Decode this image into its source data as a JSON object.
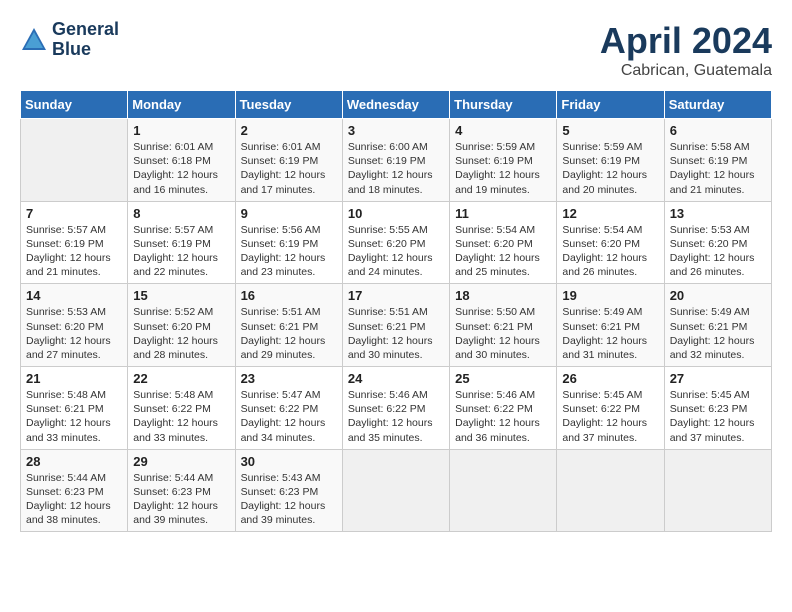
{
  "header": {
    "logo_line1": "General",
    "logo_line2": "Blue",
    "month": "April 2024",
    "location": "Cabrican, Guatemala"
  },
  "weekdays": [
    "Sunday",
    "Monday",
    "Tuesday",
    "Wednesday",
    "Thursday",
    "Friday",
    "Saturday"
  ],
  "weeks": [
    [
      {
        "num": "",
        "info": ""
      },
      {
        "num": "1",
        "info": "Sunrise: 6:01 AM\nSunset: 6:18 PM\nDaylight: 12 hours\nand 16 minutes."
      },
      {
        "num": "2",
        "info": "Sunrise: 6:01 AM\nSunset: 6:19 PM\nDaylight: 12 hours\nand 17 minutes."
      },
      {
        "num": "3",
        "info": "Sunrise: 6:00 AM\nSunset: 6:19 PM\nDaylight: 12 hours\nand 18 minutes."
      },
      {
        "num": "4",
        "info": "Sunrise: 5:59 AM\nSunset: 6:19 PM\nDaylight: 12 hours\nand 19 minutes."
      },
      {
        "num": "5",
        "info": "Sunrise: 5:59 AM\nSunset: 6:19 PM\nDaylight: 12 hours\nand 20 minutes."
      },
      {
        "num": "6",
        "info": "Sunrise: 5:58 AM\nSunset: 6:19 PM\nDaylight: 12 hours\nand 21 minutes."
      }
    ],
    [
      {
        "num": "7",
        "info": "Sunrise: 5:57 AM\nSunset: 6:19 PM\nDaylight: 12 hours\nand 21 minutes."
      },
      {
        "num": "8",
        "info": "Sunrise: 5:57 AM\nSunset: 6:19 PM\nDaylight: 12 hours\nand 22 minutes."
      },
      {
        "num": "9",
        "info": "Sunrise: 5:56 AM\nSunset: 6:19 PM\nDaylight: 12 hours\nand 23 minutes."
      },
      {
        "num": "10",
        "info": "Sunrise: 5:55 AM\nSunset: 6:20 PM\nDaylight: 12 hours\nand 24 minutes."
      },
      {
        "num": "11",
        "info": "Sunrise: 5:54 AM\nSunset: 6:20 PM\nDaylight: 12 hours\nand 25 minutes."
      },
      {
        "num": "12",
        "info": "Sunrise: 5:54 AM\nSunset: 6:20 PM\nDaylight: 12 hours\nand 26 minutes."
      },
      {
        "num": "13",
        "info": "Sunrise: 5:53 AM\nSunset: 6:20 PM\nDaylight: 12 hours\nand 26 minutes."
      }
    ],
    [
      {
        "num": "14",
        "info": "Sunrise: 5:53 AM\nSunset: 6:20 PM\nDaylight: 12 hours\nand 27 minutes."
      },
      {
        "num": "15",
        "info": "Sunrise: 5:52 AM\nSunset: 6:20 PM\nDaylight: 12 hours\nand 28 minutes."
      },
      {
        "num": "16",
        "info": "Sunrise: 5:51 AM\nSunset: 6:21 PM\nDaylight: 12 hours\nand 29 minutes."
      },
      {
        "num": "17",
        "info": "Sunrise: 5:51 AM\nSunset: 6:21 PM\nDaylight: 12 hours\nand 30 minutes."
      },
      {
        "num": "18",
        "info": "Sunrise: 5:50 AM\nSunset: 6:21 PM\nDaylight: 12 hours\nand 30 minutes."
      },
      {
        "num": "19",
        "info": "Sunrise: 5:49 AM\nSunset: 6:21 PM\nDaylight: 12 hours\nand 31 minutes."
      },
      {
        "num": "20",
        "info": "Sunrise: 5:49 AM\nSunset: 6:21 PM\nDaylight: 12 hours\nand 32 minutes."
      }
    ],
    [
      {
        "num": "21",
        "info": "Sunrise: 5:48 AM\nSunset: 6:21 PM\nDaylight: 12 hours\nand 33 minutes."
      },
      {
        "num": "22",
        "info": "Sunrise: 5:48 AM\nSunset: 6:22 PM\nDaylight: 12 hours\nand 33 minutes."
      },
      {
        "num": "23",
        "info": "Sunrise: 5:47 AM\nSunset: 6:22 PM\nDaylight: 12 hours\nand 34 minutes."
      },
      {
        "num": "24",
        "info": "Sunrise: 5:46 AM\nSunset: 6:22 PM\nDaylight: 12 hours\nand 35 minutes."
      },
      {
        "num": "25",
        "info": "Sunrise: 5:46 AM\nSunset: 6:22 PM\nDaylight: 12 hours\nand 36 minutes."
      },
      {
        "num": "26",
        "info": "Sunrise: 5:45 AM\nSunset: 6:22 PM\nDaylight: 12 hours\nand 37 minutes."
      },
      {
        "num": "27",
        "info": "Sunrise: 5:45 AM\nSunset: 6:23 PM\nDaylight: 12 hours\nand 37 minutes."
      }
    ],
    [
      {
        "num": "28",
        "info": "Sunrise: 5:44 AM\nSunset: 6:23 PM\nDaylight: 12 hours\nand 38 minutes."
      },
      {
        "num": "29",
        "info": "Sunrise: 5:44 AM\nSunset: 6:23 PM\nDaylight: 12 hours\nand 39 minutes."
      },
      {
        "num": "30",
        "info": "Sunrise: 5:43 AM\nSunset: 6:23 PM\nDaylight: 12 hours\nand 39 minutes."
      },
      {
        "num": "",
        "info": ""
      },
      {
        "num": "",
        "info": ""
      },
      {
        "num": "",
        "info": ""
      },
      {
        "num": "",
        "info": ""
      }
    ]
  ]
}
